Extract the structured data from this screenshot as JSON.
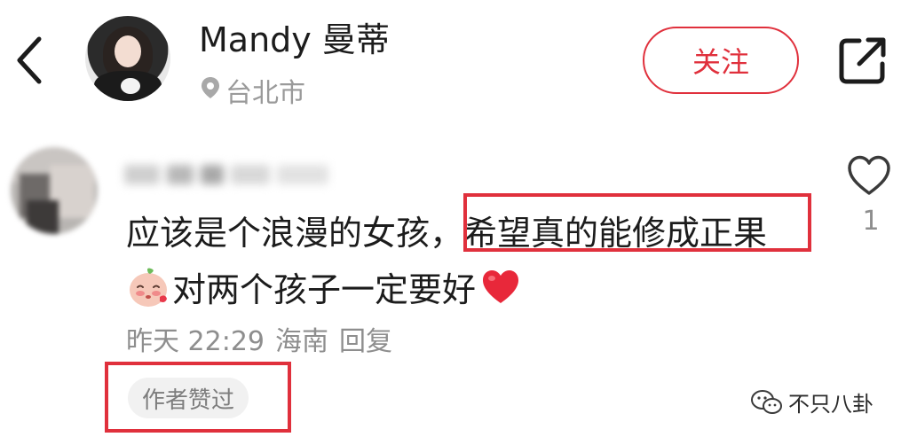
{
  "header": {
    "username": "Mandy 曼蒂",
    "location": "台北市",
    "follow_label": "关注",
    "icons": {
      "back": "back-arrow-icon",
      "location": "location-pin-icon",
      "share": "share-icon"
    }
  },
  "comment": {
    "text_part1": "应该是个浪漫的女孩，",
    "text_highlight": "希望真的能修成正果",
    "text_line2": "对两个孩子一定要好",
    "meta_time": "昨天 22:29",
    "meta_region": "海南",
    "reply_label": "回复",
    "author_liked_label": "作者赞过",
    "like_count": "1"
  },
  "watermark": {
    "text": "不只八卦"
  },
  "colors": {
    "accent": "#e0303c",
    "meta_gray": "#8e8e8e"
  }
}
